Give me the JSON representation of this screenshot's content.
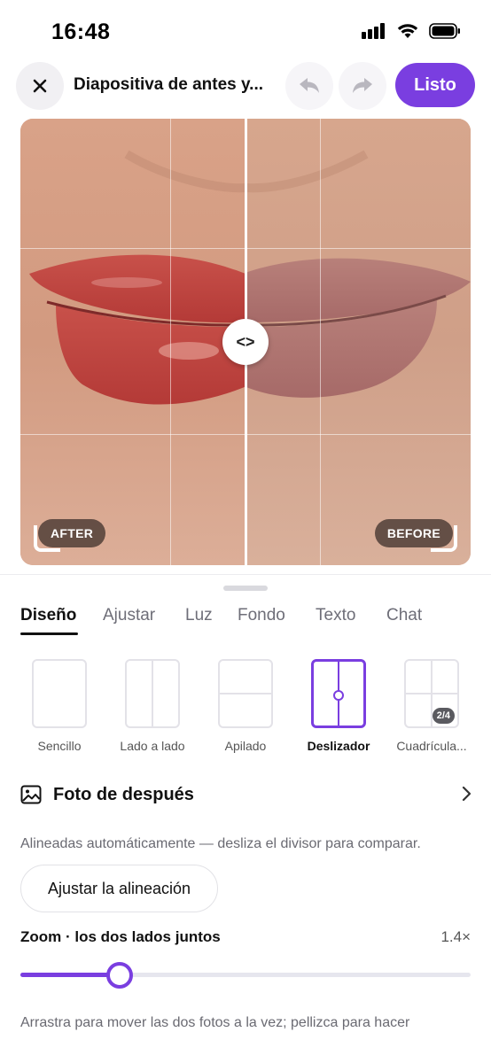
{
  "status": {
    "time": "16:48"
  },
  "header": {
    "title": "Diapositiva de antes y...",
    "done_label": "Listo"
  },
  "photo": {
    "after_label": "AFTER",
    "before_label": "BEFORE",
    "handle_glyph": "<>"
  },
  "tabs": [
    {
      "label": "Diseño",
      "active": true
    },
    {
      "label": "Ajustar"
    },
    {
      "label": "Luz"
    },
    {
      "label": "Fondo"
    },
    {
      "label": "Texto"
    },
    {
      "label": "Chat"
    }
  ],
  "layouts": [
    {
      "label": "Sencillo"
    },
    {
      "label": "Lado a lado"
    },
    {
      "label": "Apilado"
    },
    {
      "label": "Deslizador",
      "active": true
    },
    {
      "label": "Cuadrícula...",
      "badge": "2/4"
    }
  ],
  "after_photo": {
    "label": "Foto de después"
  },
  "alignment": {
    "note": "Alineadas automáticamente — desliza el divisor para comparar.",
    "button_label": "Ajustar la alineación"
  },
  "zoom": {
    "label": "Zoom · los dos lados juntos",
    "value": "1.4×",
    "fraction": 0.22
  },
  "hint": "Arrastra para mover las dos fotos a la vez; pellizca para hacer",
  "colors": {
    "accent": "#7a3ee0"
  }
}
